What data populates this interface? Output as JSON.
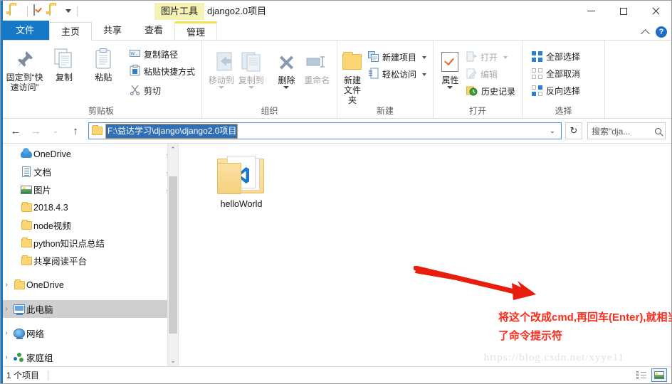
{
  "window": {
    "title": "django2.0项目",
    "contextual_tab_label": "图片工具",
    "minimize": "—",
    "maximize": "□",
    "close": "✕",
    "help_glyph": "?",
    "collapse_ribbon": "^"
  },
  "tabs": [
    {
      "label": "文件",
      "kind": "file"
    },
    {
      "label": "主页",
      "kind": "active"
    },
    {
      "label": "共享",
      "kind": "normal"
    },
    {
      "label": "查看",
      "kind": "normal"
    },
    {
      "label": "管理",
      "kind": "contextual"
    }
  ],
  "ribbon": {
    "groups": [
      {
        "title": "剪贴板",
        "big": [
          {
            "label": "固定到“快速访问”",
            "icon": "pin-icon",
            "dim": false
          },
          {
            "label": "复制",
            "icon": "copy-icon",
            "dim": false
          },
          {
            "label": "粘贴",
            "icon": "paste-icon",
            "dim": false
          }
        ],
        "small": [
          {
            "label": "复制路径",
            "icon": "copy-path-icon"
          },
          {
            "label": "粘贴快捷方式",
            "icon": "paste-shortcut-icon"
          },
          {
            "label": "剪切",
            "icon": "scissors-icon"
          }
        ]
      },
      {
        "title": "组织",
        "big": [
          {
            "label": "移动到",
            "icon": "move-to-icon",
            "dim": true
          },
          {
            "label": "复制到",
            "icon": "copy-to-icon",
            "dim": true
          },
          {
            "label": "删除",
            "icon": "delete-icon",
            "dim": false
          },
          {
            "label": "重命名",
            "icon": "rename-icon",
            "dim": true
          }
        ]
      },
      {
        "title": "新建",
        "big": [
          {
            "label": "新建文件夹",
            "icon": "new-folder-icon",
            "dim": false
          }
        ],
        "small": [
          {
            "label": "新建项目",
            "icon": "new-item-icon"
          },
          {
            "label": "轻松访问",
            "icon": "easy-access-icon"
          }
        ]
      },
      {
        "title": "打开",
        "big": [
          {
            "label": "属性",
            "icon": "properties-icon",
            "dim": false
          }
        ],
        "small": [
          {
            "label": "打开",
            "icon": "open-icon"
          },
          {
            "label": "编辑",
            "icon": "edit-icon"
          },
          {
            "label": "历史记录",
            "icon": "history-icon"
          }
        ]
      },
      {
        "title": "选择",
        "small": [
          {
            "label": "全部选择",
            "icon": "select-all-icon"
          },
          {
            "label": "全部取消",
            "icon": "select-none-icon"
          },
          {
            "label": "反向选择",
            "icon": "invert-selection-icon"
          }
        ]
      }
    ]
  },
  "navbar": {
    "back": "←",
    "forward": "→",
    "recent": "⌄",
    "up": "↑",
    "address_value": "F:\\益达学习\\django\\django2.0项目",
    "address_dropdown": "⌄",
    "refresh": "↻",
    "search_placeholder": "搜索\"dja..."
  },
  "sidebar": {
    "items": [
      {
        "label": "OneDrive",
        "icon": "onedrive-cloud-icon",
        "expander": "",
        "pinned": true,
        "indent": 26,
        "selected": false
      },
      {
        "label": "文档",
        "icon": "documents-icon",
        "expander": "",
        "pinned": true,
        "indent": 26,
        "selected": false
      },
      {
        "label": "图片",
        "icon": "pictures-icon",
        "expander": "",
        "pinned": true,
        "indent": 26,
        "selected": false
      },
      {
        "label": "2018.4.3",
        "icon": "folder-icon",
        "expander": "",
        "pinned": false,
        "indent": 26,
        "selected": false
      },
      {
        "label": "node视频",
        "icon": "folder-icon",
        "expander": "",
        "pinned": false,
        "indent": 26,
        "selected": false
      },
      {
        "label": "python知识点总结",
        "icon": "folder-icon",
        "expander": "",
        "pinned": false,
        "indent": 26,
        "selected": false
      },
      {
        "label": "共享阅读平台",
        "icon": "folder-icon",
        "expander": "",
        "pinned": false,
        "indent": 26,
        "selected": false
      },
      {
        "label": "OneDrive",
        "icon": "folder-icon",
        "expander": "›",
        "pinned": false,
        "indent": 8,
        "selected": false
      },
      {
        "label": "此电脑",
        "icon": "this-pc-icon",
        "expander": "›",
        "pinned": false,
        "indent": 8,
        "selected": true
      },
      {
        "label": "网络",
        "icon": "network-icon",
        "expander": "›",
        "pinned": false,
        "indent": 8,
        "selected": false
      },
      {
        "label": "家庭组",
        "icon": "homegroup-icon",
        "expander": "›",
        "pinned": false,
        "indent": 8,
        "selected": false
      }
    ],
    "scroll_up": "⌃",
    "scroll_down": "⌄"
  },
  "files": [
    {
      "name": "helloWorld",
      "icon": "folder-with-vscode-icon"
    }
  ],
  "annotation": {
    "text": "将这个改成cmd,再回车(Enter),就相当于在当前目录下面打开了命令提示符",
    "color": "#ff2b1b",
    "arrow_color": "#e81d0d"
  },
  "watermark": "https://blog.csdn.net/xyye11",
  "statusbar": {
    "item_count": "1 个项目",
    "view_details": "details-view-icon",
    "view_large_icons": "large-icons-view-icon"
  },
  "colors": {
    "accent": "#1679c8",
    "selection": "#2f6fb5",
    "contextual": "#f4f2b4",
    "folder": "#fcd675"
  }
}
